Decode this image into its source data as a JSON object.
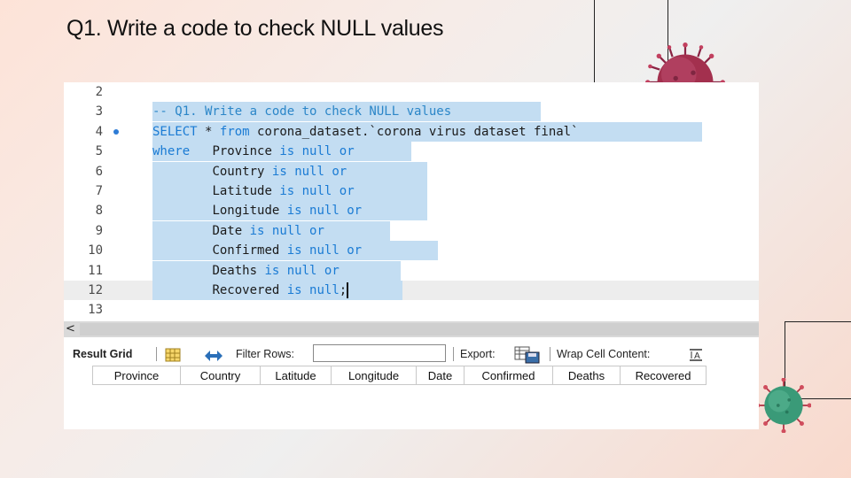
{
  "slide": {
    "title": "Q1. Write a code to check NULL values"
  },
  "editor": {
    "lines": [
      {
        "num": "2",
        "text": ""
      },
      {
        "num": "3",
        "text": "-- Q1. Write a code to check NULL values"
      },
      {
        "num": "4",
        "text": "SELECT * from corona_dataset.`corona virus dataset final`"
      },
      {
        "num": "5",
        "text": "where   Province is null or"
      },
      {
        "num": "6",
        "text": "        Country is null or"
      },
      {
        "num": "7",
        "text": "        Latitude is null or"
      },
      {
        "num": "8",
        "text": "        Longitude is null or"
      },
      {
        "num": "9",
        "text": "        Date is null or"
      },
      {
        "num": "10",
        "text": "        Confirmed is null or"
      },
      {
        "num": "11",
        "text": "        Deaths is null or"
      },
      {
        "num": "12",
        "text": "        Recovered is null;"
      },
      {
        "num": "13",
        "text": ""
      }
    ],
    "scroll_arrow": "<"
  },
  "toolbar": {
    "result_grid": "Result Grid",
    "filter_rows": "Filter Rows:",
    "filter_value": "",
    "export": "Export:",
    "wrap_cell": "Wrap Cell Content:"
  },
  "grid": {
    "columns": [
      "Province",
      "Country",
      "Latitude",
      "Longitude",
      "Date",
      "Confirmed",
      "Deaths",
      "Recovered"
    ]
  },
  "colors": {
    "keyword": "#1a7bd4",
    "selection": "#c3ddf2",
    "virus_red": "#a3304e",
    "virus_green": "#3a9a78"
  }
}
